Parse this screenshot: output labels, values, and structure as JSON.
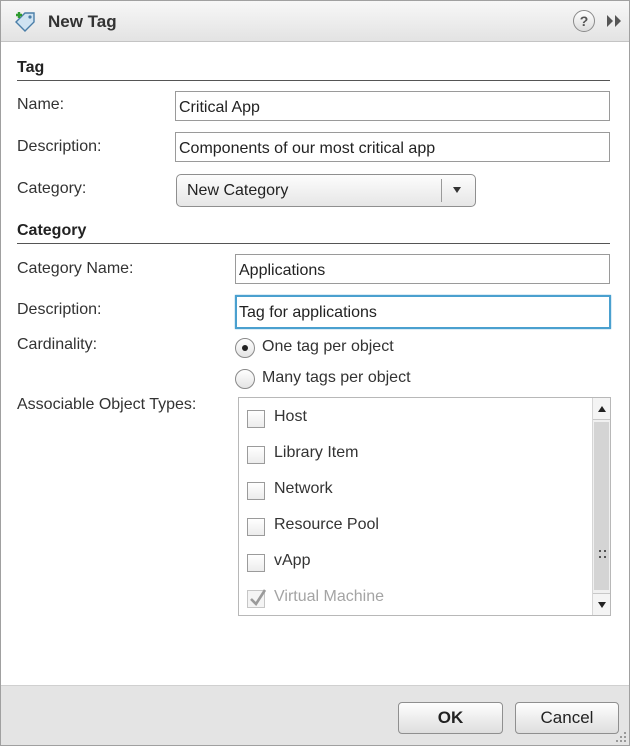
{
  "window": {
    "title": "New Tag",
    "icon": "new-tag-icon",
    "help_icon": "?",
    "accent_color": "#4aa0cf"
  },
  "tag_section": {
    "heading": "Tag",
    "name_label": "Name:",
    "name_value": "Critical App",
    "description_label": "Description:",
    "description_value": "Components of our most critical app",
    "category_label": "Category:",
    "category_selected": "New Category"
  },
  "category_section": {
    "heading": "Category",
    "name_label": "Category Name:",
    "name_value": "Applications",
    "description_label": "Description:",
    "description_value": "Tag for applications",
    "cardinality_label": "Cardinality:",
    "cardinality_options": [
      {
        "label": "One tag per object",
        "selected": true
      },
      {
        "label": "Many tags per object",
        "selected": false
      }
    ],
    "object_types_label": "Associable Object Types:",
    "object_types": [
      {
        "label": "Host",
        "checked": false,
        "disabled": false
      },
      {
        "label": "Library Item",
        "checked": false,
        "disabled": false
      },
      {
        "label": "Network",
        "checked": false,
        "disabled": false
      },
      {
        "label": "Resource Pool",
        "checked": false,
        "disabled": false
      },
      {
        "label": "vApp",
        "checked": false,
        "disabled": false
      },
      {
        "label": "Virtual Machine",
        "checked": true,
        "disabled": true
      }
    ]
  },
  "footer": {
    "ok_label": "OK",
    "cancel_label": "Cancel"
  }
}
